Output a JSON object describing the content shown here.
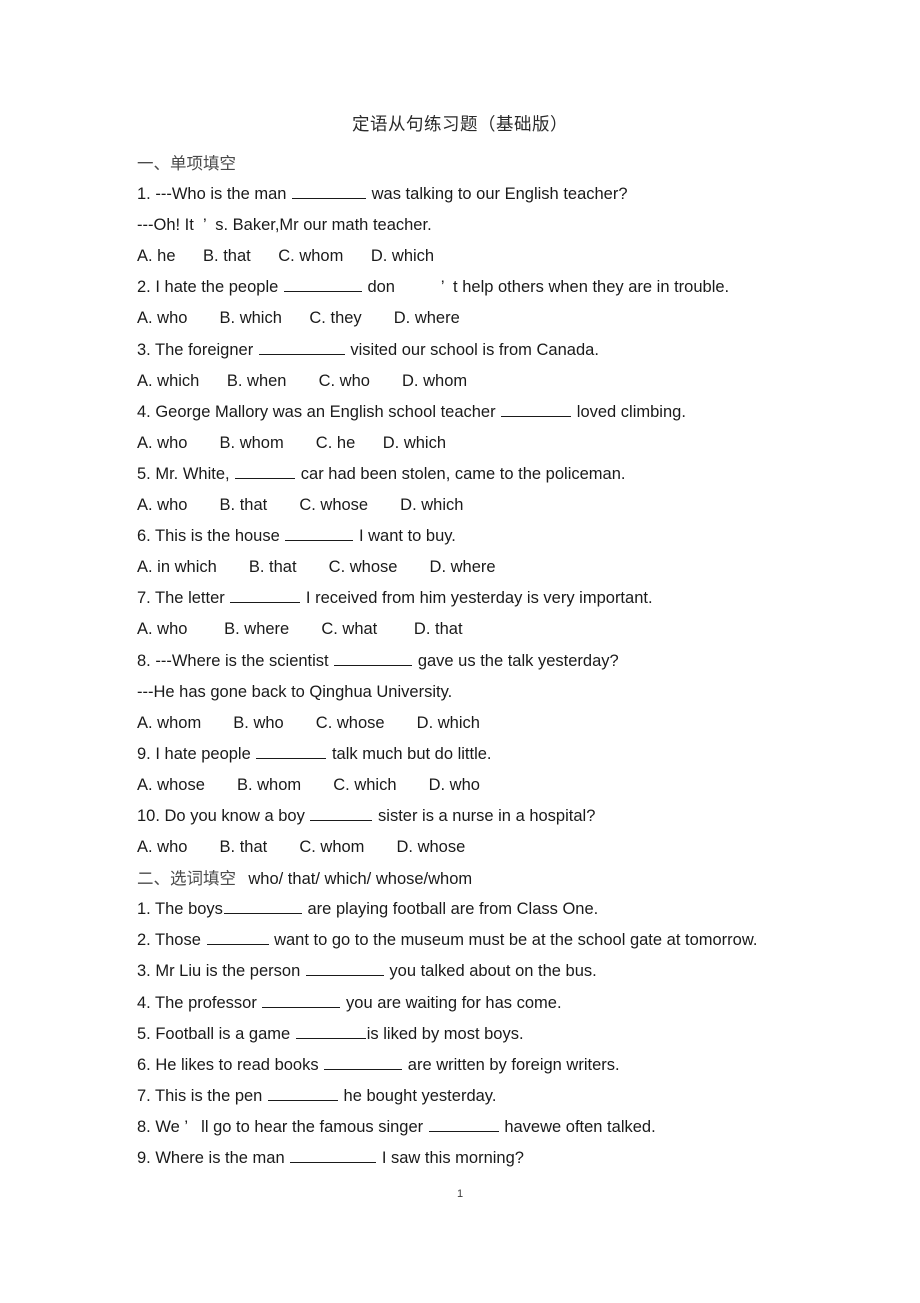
{
  "document": {
    "title": "定语从句练习题（基础版）",
    "page_number": "1",
    "sections": [
      {
        "heading_cn": "一、单项填空",
        "heading_en": "",
        "lines": [
          {
            "kind": "question",
            "pre": "1. ---Who is the man ",
            "blank": 74,
            "post": " was talking to our English teacher?"
          },
          {
            "kind": "text",
            "text": "---Oh! It  ’  s. Baker,Mr our math teacher."
          },
          {
            "kind": "text",
            "text": "A. he      B. that      C. whom      D. which"
          },
          {
            "kind": "question",
            "pre": "2. I hate the people ",
            "blank": 78,
            "post": " don          ’  t help others when they are in trouble."
          },
          {
            "kind": "text",
            "text": "A. who       B. which      C. they       D. where"
          },
          {
            "kind": "question",
            "pre": "3. The foreigner ",
            "blank": 86,
            "post": " visited our school is from Canada."
          },
          {
            "kind": "text",
            "text": "A. which      B. when       C. who       D. whom"
          },
          {
            "kind": "question",
            "pre": "4. George Mallory was an English school teacher ",
            "blank": 70,
            "post": " loved climbing."
          },
          {
            "kind": "text",
            "text": "A. who       B. whom       C. he      D. which"
          },
          {
            "kind": "question",
            "pre": "5. Mr. White, ",
            "blank": 60,
            "post": " car had been stolen, came to the policeman."
          },
          {
            "kind": "text",
            "text": "A. who       B. that       C. whose       D. which"
          },
          {
            "kind": "question",
            "pre": "6. This is the house ",
            "blank": 68,
            "post": " I want to buy."
          },
          {
            "kind": "text",
            "text": "A. in which       B. that       C. whose       D. where"
          },
          {
            "kind": "question",
            "pre": "7. The letter ",
            "blank": 70,
            "post": " I received from him yesterday is very important."
          },
          {
            "kind": "text",
            "text": "A. who        B. where       C. what        D. that"
          },
          {
            "kind": "question",
            "pre": "8. ---Where is the scientist ",
            "blank": 78,
            "post": " gave us the talk yesterday?"
          },
          {
            "kind": "text",
            "text": "---He has gone back to Qinghua University."
          },
          {
            "kind": "text",
            "text": "A. whom       B. who       C. whose       D. which"
          },
          {
            "kind": "question",
            "pre": "9. I hate people ",
            "blank": 70,
            "post": " talk much but do little."
          },
          {
            "kind": "text",
            "text": "A. whose       B. whom       C. which       D. who"
          },
          {
            "kind": "question",
            "pre": "10. Do you know a boy ",
            "blank": 62,
            "post": " sister is a nurse in a hospital?"
          },
          {
            "kind": "text",
            "text": "A. who       B. that       C. whom       D. whose"
          }
        ]
      },
      {
        "heading_cn": "二、选词填空",
        "heading_en": "who/ that/ which/ whose/whom",
        "lines": [
          {
            "kind": "question",
            "pre": "1. The boys",
            "blank": 78,
            "post": " are playing football are from Class One."
          },
          {
            "kind": "question",
            "pre": "2. Those ",
            "blank": 62,
            "post": " want to go to the museum must be at the school gate at tomorrow."
          },
          {
            "kind": "question",
            "pre": "3. Mr Liu is the person ",
            "blank": 78,
            "post": " you talked about on the bus."
          },
          {
            "kind": "question",
            "pre": "4. The professor ",
            "blank": 78,
            "post": " you are waiting for has come."
          },
          {
            "kind": "question",
            "pre": "5. Football is a game ",
            "blank": 70,
            "post": "is liked by most boys."
          },
          {
            "kind": "question",
            "pre": "6. He likes to read books ",
            "blank": 78,
            "post": " are written by foreign writers."
          },
          {
            "kind": "question",
            "pre": "7. This is the pen ",
            "blank": 70,
            "post": " he bought yesterday."
          },
          {
            "kind": "question",
            "pre": "8. We ’   ll go to hear the famous singer ",
            "blank": 70,
            "post": " havewe often talked."
          },
          {
            "kind": "question",
            "pre": "9. Where is the man ",
            "blank": 86,
            "post": " I saw this morning?"
          }
        ]
      }
    ]
  }
}
